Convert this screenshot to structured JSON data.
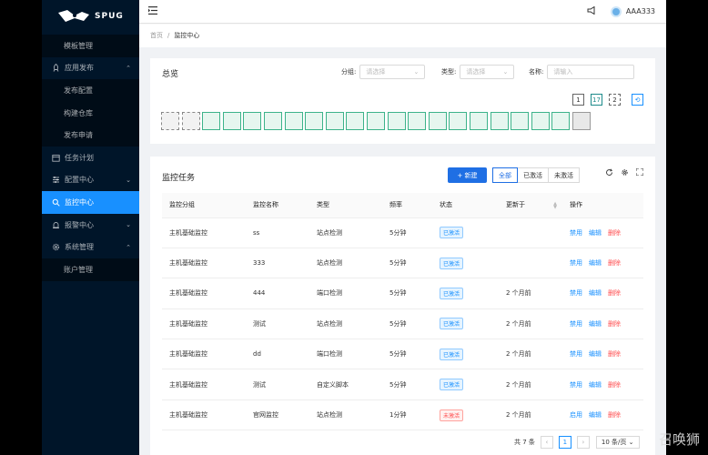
{
  "app": {
    "logo_text": "SPUG"
  },
  "sidebar": {
    "items": [
      {
        "label": "模板管理",
        "type": "sub"
      },
      {
        "label": "应用发布",
        "type": "top",
        "icon": "rocket-icon",
        "arrow": "⌃"
      },
      {
        "label": "发布配置",
        "type": "sub"
      },
      {
        "label": "构建仓库",
        "type": "sub"
      },
      {
        "label": "发布申请",
        "type": "sub"
      },
      {
        "label": "任务计划",
        "type": "top",
        "icon": "calendar-icon"
      },
      {
        "label": "配置中心",
        "type": "top",
        "icon": "config-icon",
        "arrow": "⌄"
      },
      {
        "label": "监控中心",
        "type": "top",
        "icon": "monitor-icon",
        "active": true
      },
      {
        "label": "报警中心",
        "type": "top",
        "icon": "alarm-icon",
        "arrow": "⌄"
      },
      {
        "label": "系统管理",
        "type": "top",
        "icon": "settings-icon",
        "arrow": "⌃"
      },
      {
        "label": "账户管理",
        "type": "sub"
      }
    ]
  },
  "header": {
    "username": "AAA333"
  },
  "breadcrumb": {
    "home": "首页",
    "sep": "/",
    "current": "监控中心"
  },
  "overview": {
    "title": "总览",
    "filters": {
      "group_label": "分组:",
      "group_placeholder": "请选择",
      "type_label": "类型:",
      "type_placeholder": "请选择",
      "name_label": "名称:",
      "name_placeholder": "请输入"
    },
    "toggles": [
      "1",
      "17",
      "2",
      "⟲"
    ]
  },
  "tasks": {
    "title": "监控任务",
    "new_button": "+ 新建",
    "radio": [
      "全部",
      "已激活",
      "未激活"
    ],
    "columns": [
      "监控分组",
      "监控名称",
      "类型",
      "频率",
      "状态",
      "更新于",
      "操作"
    ],
    "rows": [
      {
        "group": "主机基础监控",
        "name": "ss",
        "type": "站点检测",
        "freq": "5分钟",
        "status": "已激活",
        "active": true,
        "updated": "",
        "toggle": "禁用"
      },
      {
        "group": "主机基础监控",
        "name": "333",
        "type": "站点检测",
        "freq": "5分钟",
        "status": "已激活",
        "active": true,
        "updated": "",
        "toggle": "禁用"
      },
      {
        "group": "主机基础监控",
        "name": "444",
        "type": "端口检测",
        "freq": "5分钟",
        "status": "已激活",
        "active": true,
        "updated": "2 个月前",
        "toggle": "禁用"
      },
      {
        "group": "主机基础监控",
        "name": "测试",
        "type": "站点检测",
        "freq": "5分钟",
        "status": "已激活",
        "active": true,
        "updated": "2 个月前",
        "toggle": "禁用"
      },
      {
        "group": "主机基础监控",
        "name": "dd",
        "type": "端口检测",
        "freq": "5分钟",
        "status": "已激活",
        "active": true,
        "updated": "2 个月前",
        "toggle": "禁用"
      },
      {
        "group": "主机基础监控",
        "name": "测试",
        "type": "自定义脚本",
        "freq": "5分钟",
        "status": "已激活",
        "active": true,
        "updated": "2 个月前",
        "toggle": "禁用"
      },
      {
        "group": "主机基础监控",
        "name": "官网监控",
        "type": "站点检测",
        "freq": "1分钟",
        "status": "未激活",
        "active": false,
        "updated": "2 个月前",
        "toggle": "启用"
      }
    ],
    "edit_label": "编辑",
    "delete_label": "删除",
    "pager": {
      "total": "共 7 条",
      "page": "1",
      "size": "10 条/页"
    }
  },
  "watermark": "召唤狮",
  "colors": {
    "sidebar_bg": "#001529",
    "accent": "#1890ff",
    "status_on": "#3cb38a"
  }
}
